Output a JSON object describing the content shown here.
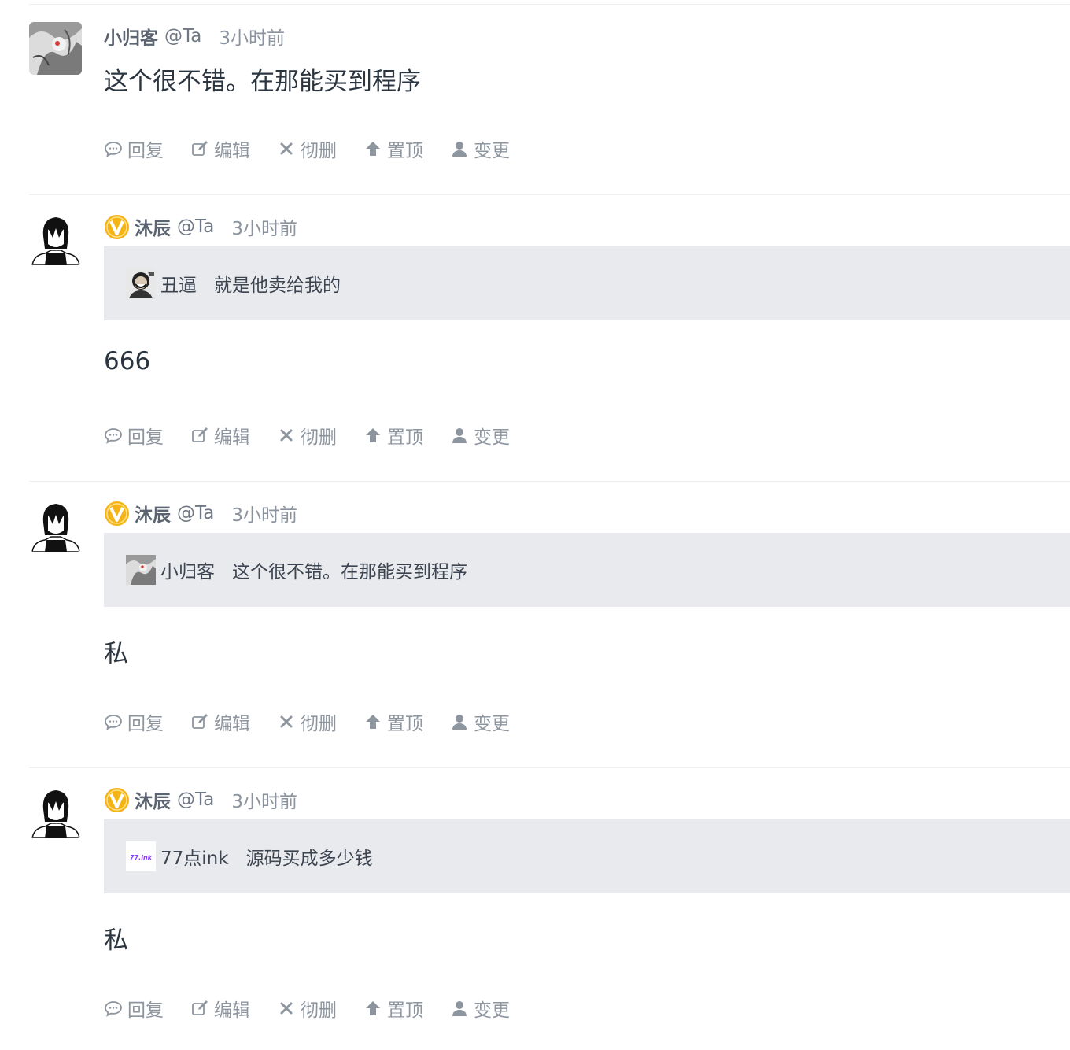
{
  "comments": [
    {
      "author": "小归客",
      "at": "@Ta",
      "time": "3小时前",
      "avatar_icon": "ink-painting-avatar",
      "vip": false,
      "body": "这个很不错。在那能买到程序",
      "quote": null
    },
    {
      "author": "沐辰",
      "at": "@Ta",
      "time": "3小时前",
      "avatar_icon": "anime-boy-avatar",
      "vip": true,
      "quote": {
        "author": "丑逼",
        "text": "就是他卖给我的",
        "avatar_icon": "photo-avatar"
      },
      "body": "666"
    },
    {
      "author": "沐辰",
      "at": "@Ta",
      "time": "3小时前",
      "avatar_icon": "anime-boy-avatar",
      "vip": true,
      "quote": {
        "author": "小归客",
        "text": "这个很不错。在那能买到程序",
        "avatar_icon": "ink-painting-avatar"
      },
      "body": "私"
    },
    {
      "author": "沐辰",
      "at": "@Ta",
      "time": "3小时前",
      "avatar_icon": "anime-boy-avatar",
      "vip": true,
      "quote": {
        "author": "77点ink",
        "text": "源码买成多少钱",
        "avatar_icon": "77ink-logo-avatar",
        "logo_text": "77.ink"
      },
      "body": "私"
    }
  ],
  "actions": {
    "reply": "回复",
    "edit": "编辑",
    "delete": "彻删",
    "pin": "置顶",
    "change": "变更"
  },
  "colors": {
    "quote_bg": "#e9eaed",
    "vip_badge": "#f5b416",
    "muted_text": "#8d959f"
  }
}
